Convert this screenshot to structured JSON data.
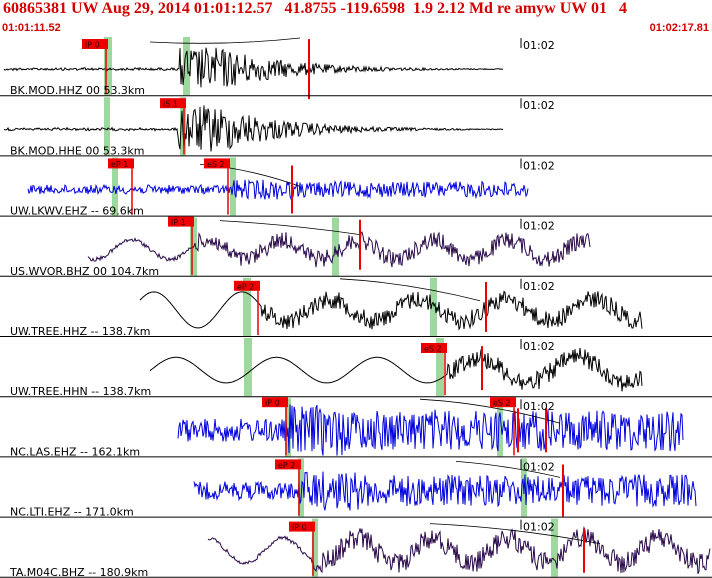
{
  "header": {
    "title": "60865381 UW Aug 29, 2014 01:01:12.57   41.8755 -119.6598  1.9 2.12 Md re amyw UW 01   4",
    "time_start": "01:01:11.52",
    "time_end": "01:02:17.81"
  },
  "colors": {
    "header_text": "#d40000",
    "pick_flag": "#ee0000",
    "pick_window": "#9fd89f",
    "trace_black": "#000000",
    "trace_blue": "#0000dd",
    "trace_purple": "#2a0a4a",
    "divider": "#000000"
  },
  "traces": [
    {
      "label": "BK.MOD.HHZ 00 53.3km",
      "minute_tick": "01:02",
      "picks": [
        "iP 0"
      ],
      "color": "black"
    },
    {
      "label": "BK.MOD.HHE 00 53.3km",
      "minute_tick": "01:02",
      "picks": [
        "iS 1"
      ],
      "color": "black"
    },
    {
      "label": "UW.LKWV.EHZ -- 69.6km",
      "minute_tick": "01:02",
      "picks": [
        "eP 1",
        "eS 2"
      ],
      "color": "blue"
    },
    {
      "label": "US.WVOR.BHZ 00 104.7km",
      "minute_tick": "01:02",
      "picks": [
        "iP 1"
      ],
      "color": "purple"
    },
    {
      "label": "UW.TREE.HHZ -- 138.7km",
      "minute_tick": "01:02",
      "picks": [
        "eP 2"
      ],
      "color": "black"
    },
    {
      "label": "UW.TREE.HHN -- 138.7km",
      "minute_tick": "01:02",
      "picks": [
        "eS 2"
      ],
      "color": "black"
    },
    {
      "label": "NC.LAS.EHZ -- 162.1km",
      "minute_tick": "01:02",
      "picks": [
        "iP 0",
        "eS 2"
      ],
      "color": "blue"
    },
    {
      "label": "NC.LTI.EHZ -- 171.0km",
      "minute_tick": "01:02",
      "picks": [
        "eP 2"
      ],
      "color": "blue"
    },
    {
      "label": "TA.M04C.BHZ -- 180.9km",
      "minute_tick": "01:02",
      "picks": [
        "iP 0"
      ],
      "color": "purple"
    }
  ]
}
